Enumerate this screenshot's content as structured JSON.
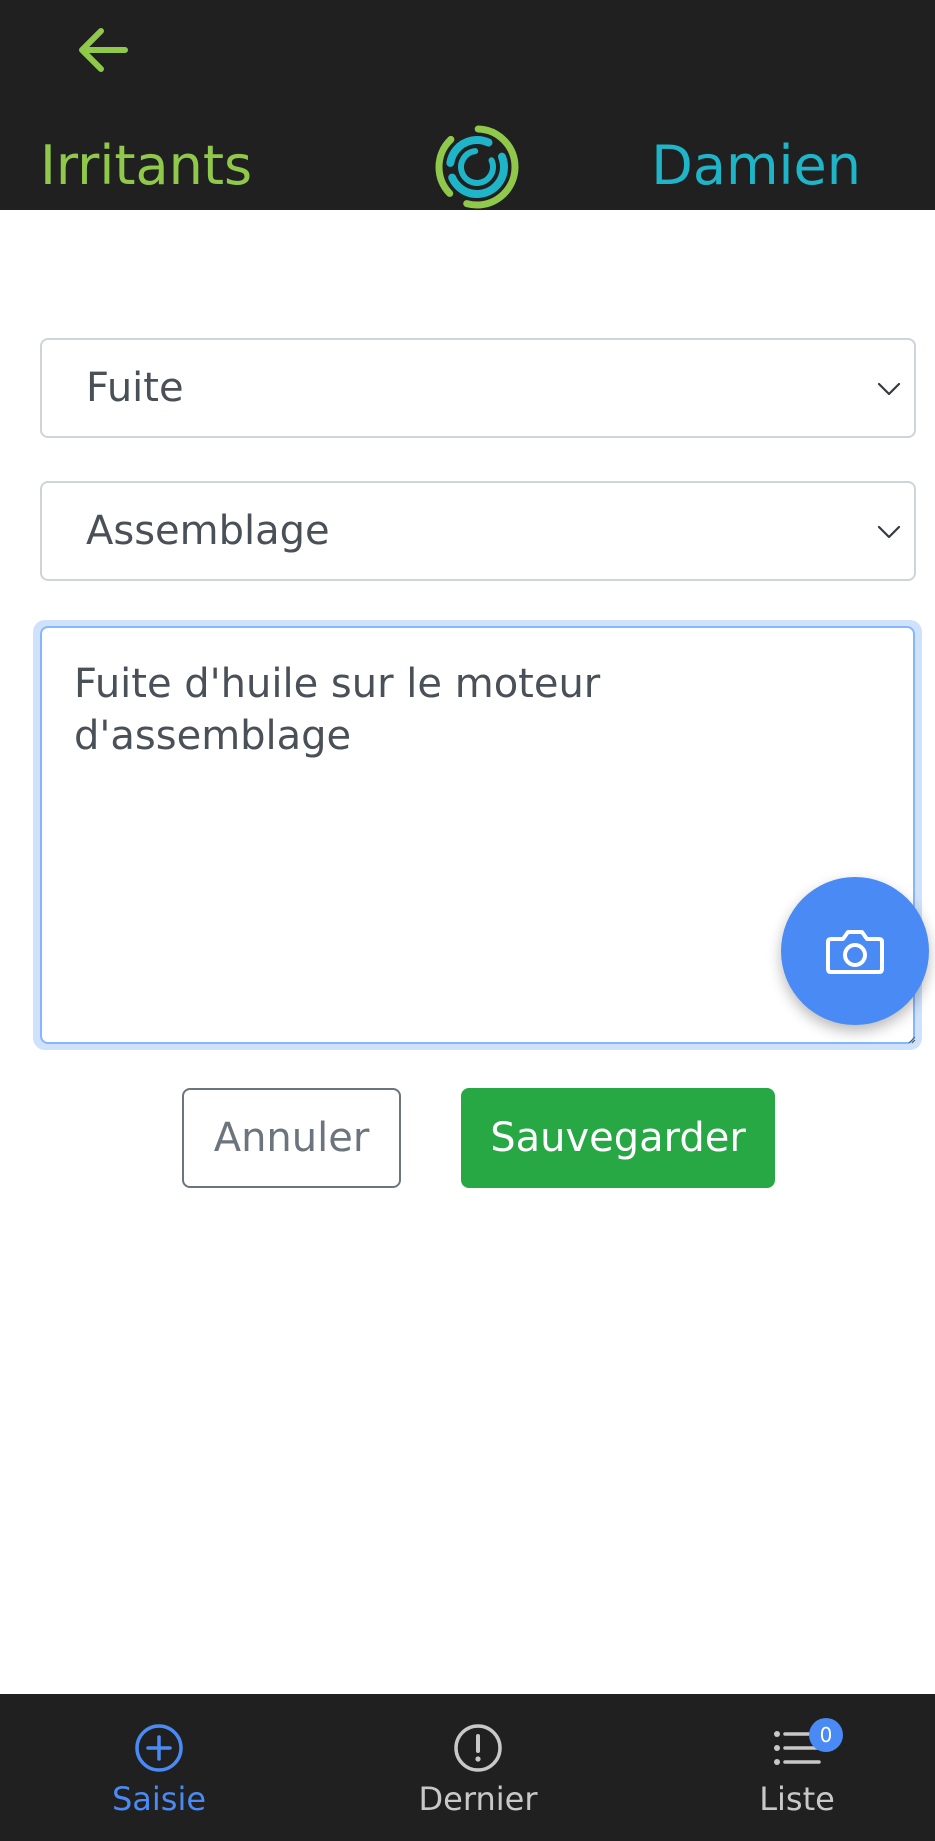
{
  "header": {
    "app_title": "Irritants",
    "user_name": "Damien",
    "back_icon": "arrow-left-icon",
    "logo_icon": "swirl-logo-icon",
    "colors": {
      "background": "#202020",
      "title": "#8fc84a",
      "user": "#1fb5c9"
    }
  },
  "form": {
    "type_select": {
      "value": "Fuite"
    },
    "location_select": {
      "value": "Assemblage"
    },
    "description": {
      "value": "Fuite d'huile sur le moteur d'assemblage"
    },
    "camera_icon": "camera-icon",
    "cancel_label": "Annuler",
    "save_label": "Sauvegarder",
    "colors": {
      "save": "#28a745",
      "fab": "#4a8af4",
      "focus_border": "#86b7fe"
    }
  },
  "bottom_nav": {
    "items": [
      {
        "label": "Saisie",
        "icon": "plus-circle-icon",
        "active": true
      },
      {
        "label": "Dernier",
        "icon": "exclamation-circle-icon",
        "active": false
      },
      {
        "label": "Liste",
        "icon": "list-icon",
        "active": false,
        "badge": "0"
      }
    ],
    "colors": {
      "active": "#4a8af4",
      "inactive": "#c8c8c8"
    }
  }
}
